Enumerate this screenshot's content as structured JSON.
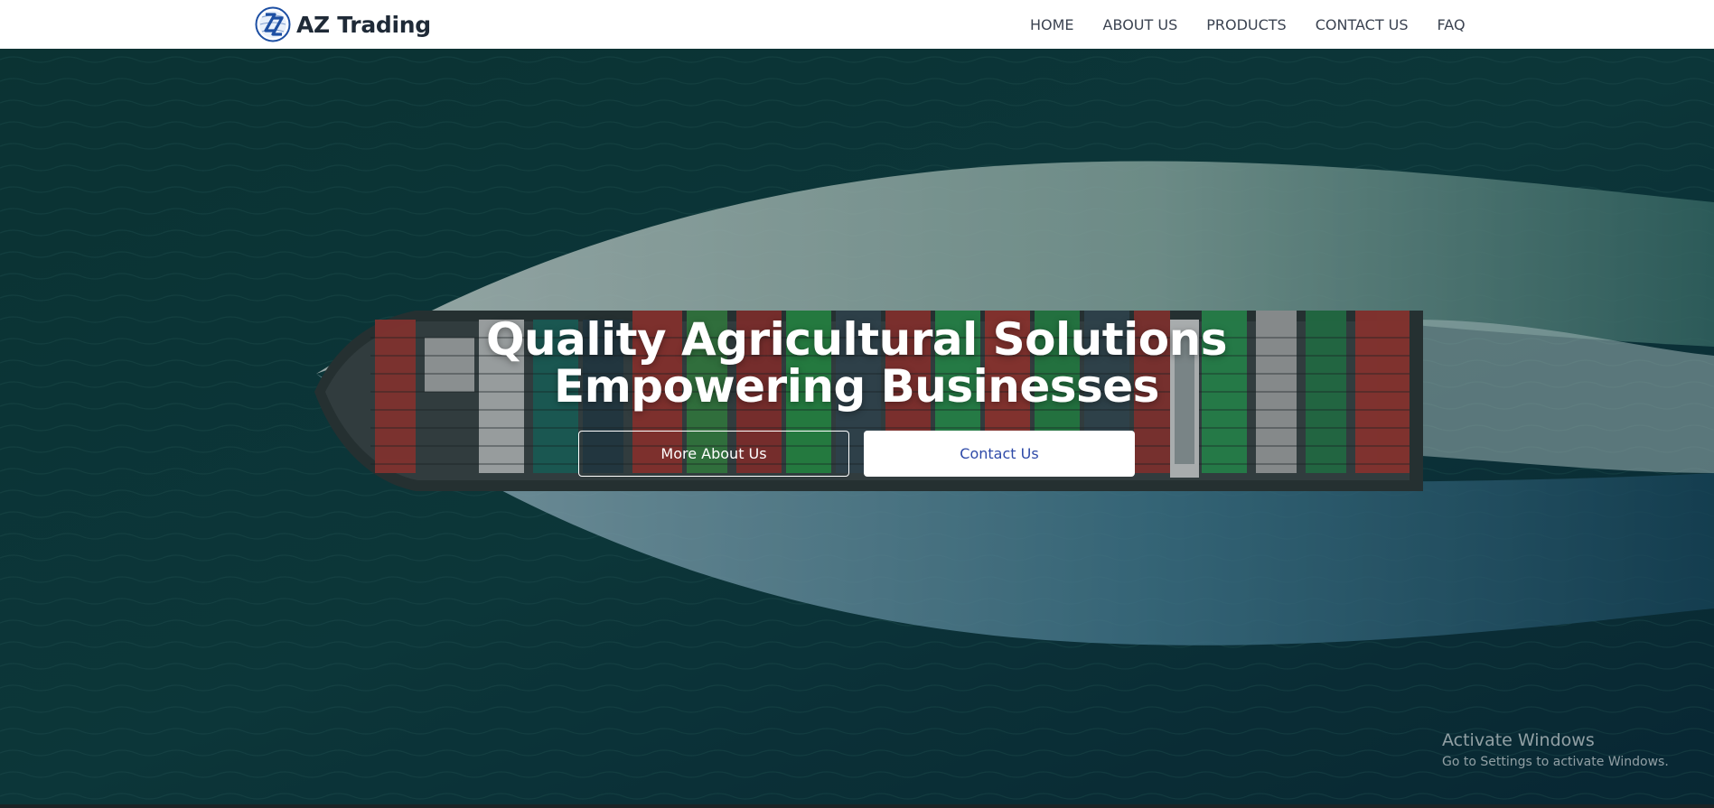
{
  "brand": {
    "name": "AZ Trading",
    "logo_icon": "globe-az-logo-icon"
  },
  "nav": {
    "items": [
      {
        "label": "HOME"
      },
      {
        "label": "ABOUT US"
      },
      {
        "label": "PRODUCTS"
      },
      {
        "label": "CONTACT US"
      },
      {
        "label": "FAQ"
      }
    ]
  },
  "hero": {
    "title_line1": "Quality Agricultural Solutions",
    "title_line2": "Empowering Businesses",
    "primary_button": "More About Us",
    "secondary_button": "Contact Us",
    "background": "container-ship-aerial-image"
  },
  "watermark": {
    "title": "Activate Windows",
    "subtitle": "Go to Settings to activate Windows."
  },
  "colors": {
    "nav_bg": "#ffffff",
    "brand_text": "#1f2a37",
    "nav_text": "#3b4351",
    "sea": "#0e3a40",
    "contact_button_text": "#2e4aa8",
    "logo_blue": "#1d4fa3"
  }
}
